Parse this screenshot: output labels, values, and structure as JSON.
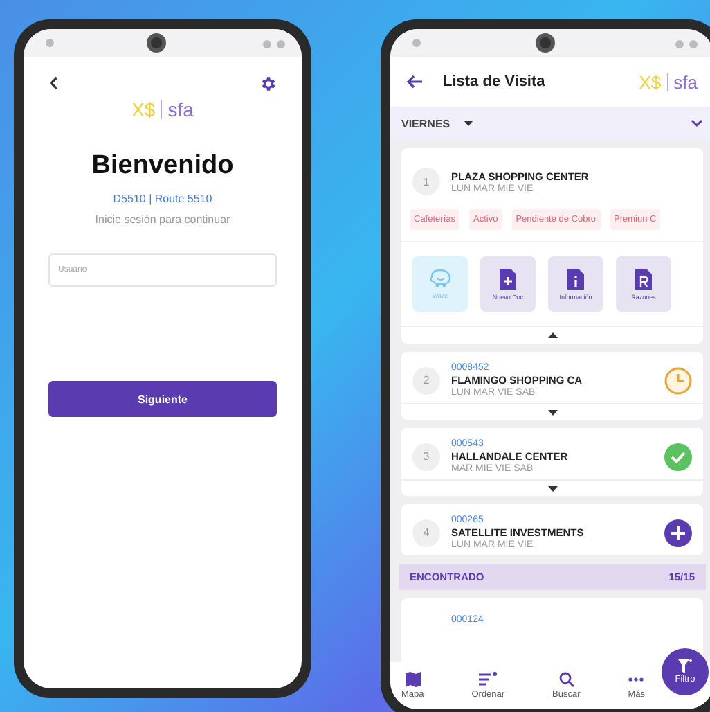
{
  "login": {
    "logo": {
      "mark": "X$",
      "name": "sfa"
    },
    "title": "Bienvenido",
    "route": "D5510 | Route 5510",
    "subtitle": "Inicie sesión para continuar",
    "username": {
      "placeholder": "Usuario"
    },
    "button": "Siguiente"
  },
  "visits": {
    "title": "Lista de Visita",
    "logo": {
      "mark": "X$",
      "name": "sfa"
    },
    "day": "VIERNES",
    "stops": [
      {
        "number": "1",
        "name": "PLAZA SHOPPING CENTER",
        "days": "LUN MAR MIE VIE",
        "expanded": true,
        "tags": [
          "Cafeterías",
          "Activo",
          "Pendiente de Cobro",
          "Premiun C"
        ],
        "actions": [
          {
            "kind": "waze",
            "label": "Waze"
          },
          {
            "kind": "doc",
            "label": "Nuevo Doc"
          },
          {
            "kind": "info",
            "label": "Información"
          },
          {
            "kind": "reasons",
            "label": "Razones"
          }
        ]
      },
      {
        "number": "2",
        "code": "0008452",
        "name": "FLAMINGO SHOPPING CA",
        "days": "LUN MAR VIE SAB",
        "kind": "pending",
        "expanded": false
      },
      {
        "number": "3",
        "code": "000543",
        "name": "HALLANDALE CENTER",
        "days": "MAR MIE VIE SAB",
        "kind": "done",
        "expanded": false
      },
      {
        "number": "4",
        "code": "000265",
        "name": "SATELLITE INVESTMENTS",
        "days": "LUN MAR MIE VIE",
        "kind": "add"
      }
    ],
    "found": {
      "label": "ENCONTRADO",
      "count": "15/15"
    },
    "next_code": "000124",
    "nav": [
      {
        "kind": "map",
        "label": "Mapa"
      },
      {
        "kind": "sort",
        "label": "Ordenar"
      },
      {
        "kind": "search",
        "label": "Buscar"
      },
      {
        "kind": "more",
        "label": "Más"
      }
    ],
    "fab": "Filtro"
  }
}
